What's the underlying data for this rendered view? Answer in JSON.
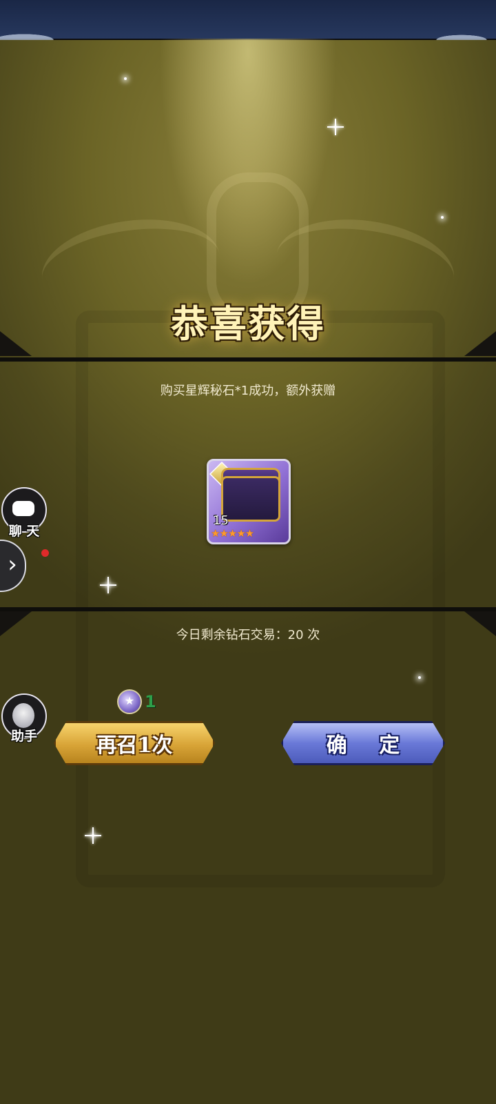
{
  "header": {
    "title": "恭喜获得"
  },
  "purchase": {
    "message": "购买星辉秘石*1成功，额外获赠"
  },
  "reward_item": {
    "icon": "treasure-chest-icon",
    "level": "15",
    "stars": "★★★★★",
    "star_count": 5
  },
  "sidebar": {
    "chat": {
      "label": "聊 天",
      "icon": "chat-bubble-icon"
    },
    "assistant": {
      "label": "助手",
      "icon": "assistant-avatar-icon"
    }
  },
  "trade": {
    "remaining_text": "今日剩余钻石交易：20 次"
  },
  "cost": {
    "value": "1",
    "icon": "summon-ticket-icon"
  },
  "buttons": {
    "summon_again": "再召1次",
    "confirm": "确 定"
  },
  "colors": {
    "gold_button": "#d8a437",
    "blue_button": "#6a79d8",
    "title_glow": "#e6b84a",
    "cost_green": "#2e9e4a"
  }
}
